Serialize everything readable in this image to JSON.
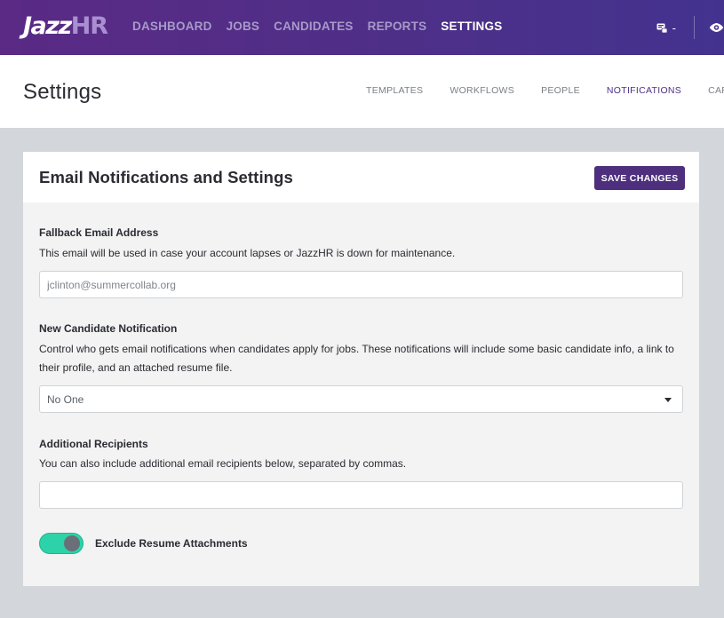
{
  "brand": {
    "logo_main": "Jazz",
    "logo_accent": "HR"
  },
  "nav": {
    "items": [
      {
        "label": "DASHBOARD",
        "active": false
      },
      {
        "label": "JOBS",
        "active": false
      },
      {
        "label": "CANDIDATES",
        "active": false
      },
      {
        "label": "REPORTS",
        "active": false
      },
      {
        "label": "SETTINGS",
        "active": true
      }
    ],
    "notifications_count": "-"
  },
  "page": {
    "title": "Settings"
  },
  "subnav": {
    "items": [
      {
        "label": "TEMPLATES",
        "active": false
      },
      {
        "label": "WORKFLOWS",
        "active": false
      },
      {
        "label": "PEOPLE",
        "active": false
      },
      {
        "label": "NOTIFICATIONS",
        "active": true
      },
      {
        "label": "CAREERS",
        "active": false
      }
    ]
  },
  "card": {
    "title": "Email Notifications and Settings",
    "save_label": "SAVE CHANGES",
    "fallback": {
      "label": "Fallback Email Address",
      "help": "This email will be used in case your account lapses or JazzHR is down for maintenance.",
      "placeholder": "jclinton@summercollab.org",
      "value": ""
    },
    "new_candidate": {
      "label": "New Candidate Notification",
      "help": "Control who gets email notifications when candidates apply for jobs. These notifications will include some basic candidate info, a link to their profile, and an attached resume file.",
      "selected": "No One"
    },
    "additional": {
      "label": "Additional Recipients",
      "help": "You can also include additional email recipients below, separated by commas.",
      "placeholder": "",
      "value": ""
    },
    "exclude_resume": {
      "label": "Exclude Resume Attachments",
      "enabled": true
    }
  },
  "colors": {
    "brand_purple": "#4e2f88",
    "button_purple": "#4e2f7e",
    "toggle_on": "#2dd3a8"
  }
}
